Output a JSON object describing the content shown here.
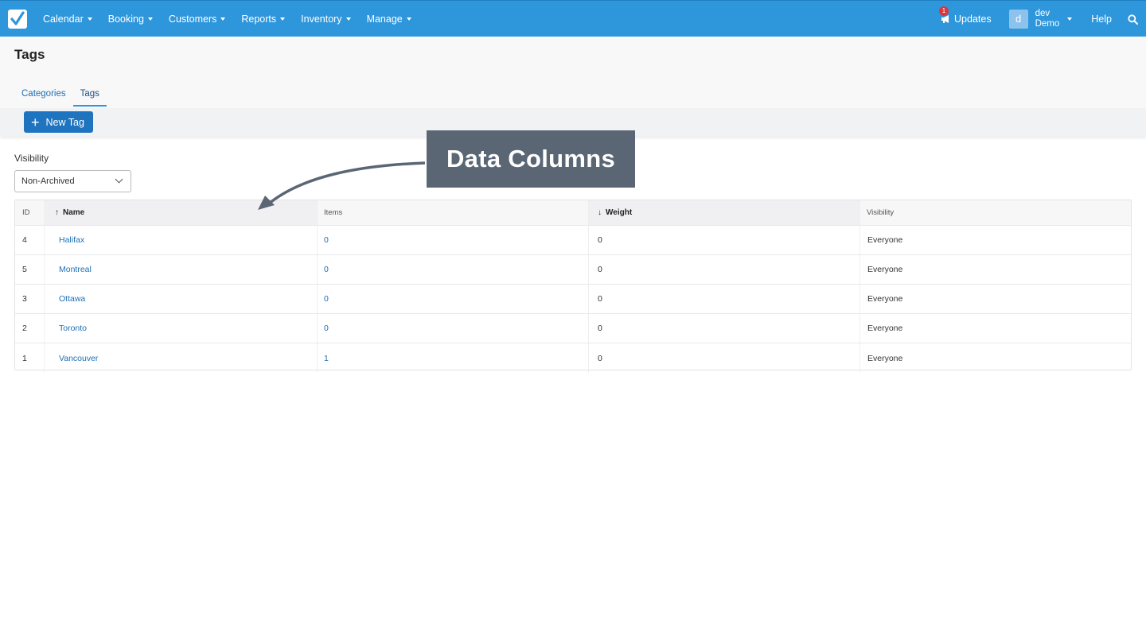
{
  "nav": {
    "items": [
      "Calendar",
      "Booking",
      "Customers",
      "Reports",
      "Inventory",
      "Manage"
    ],
    "updates_label": "Updates",
    "updates_badge": "1",
    "user": {
      "avatar_letter": "d",
      "line1": "dev",
      "line2": "Demo"
    },
    "help_label": "Help",
    "brand_color": "#2e96db"
  },
  "page": {
    "title": "Tags",
    "tabs": [
      {
        "label": "Categories",
        "active": false
      },
      {
        "label": "Tags",
        "active": true
      }
    ],
    "new_button": "New Tag"
  },
  "filter": {
    "label": "Visibility",
    "selected": "Non-Archived"
  },
  "table": {
    "headers": {
      "id": "ID",
      "name": "Name",
      "items": "Items",
      "weight": "Weight",
      "visibility": "Visibility"
    },
    "sort_up": "↑",
    "sort_down": "↓",
    "rows": [
      {
        "id": "4",
        "name": "Halifax",
        "items": "0",
        "weight": "0",
        "visibility": "Everyone"
      },
      {
        "id": "5",
        "name": "Montreal",
        "items": "0",
        "weight": "0",
        "visibility": "Everyone"
      },
      {
        "id": "3",
        "name": "Ottawa",
        "items": "0",
        "weight": "0",
        "visibility": "Everyone"
      },
      {
        "id": "2",
        "name": "Toronto",
        "items": "0",
        "weight": "0",
        "visibility": "Everyone"
      },
      {
        "id": "1",
        "name": "Vancouver",
        "items": "1",
        "weight": "0",
        "visibility": "Everyone"
      }
    ]
  },
  "annotation": {
    "label": "Data Columns",
    "color": "#5b6675"
  }
}
